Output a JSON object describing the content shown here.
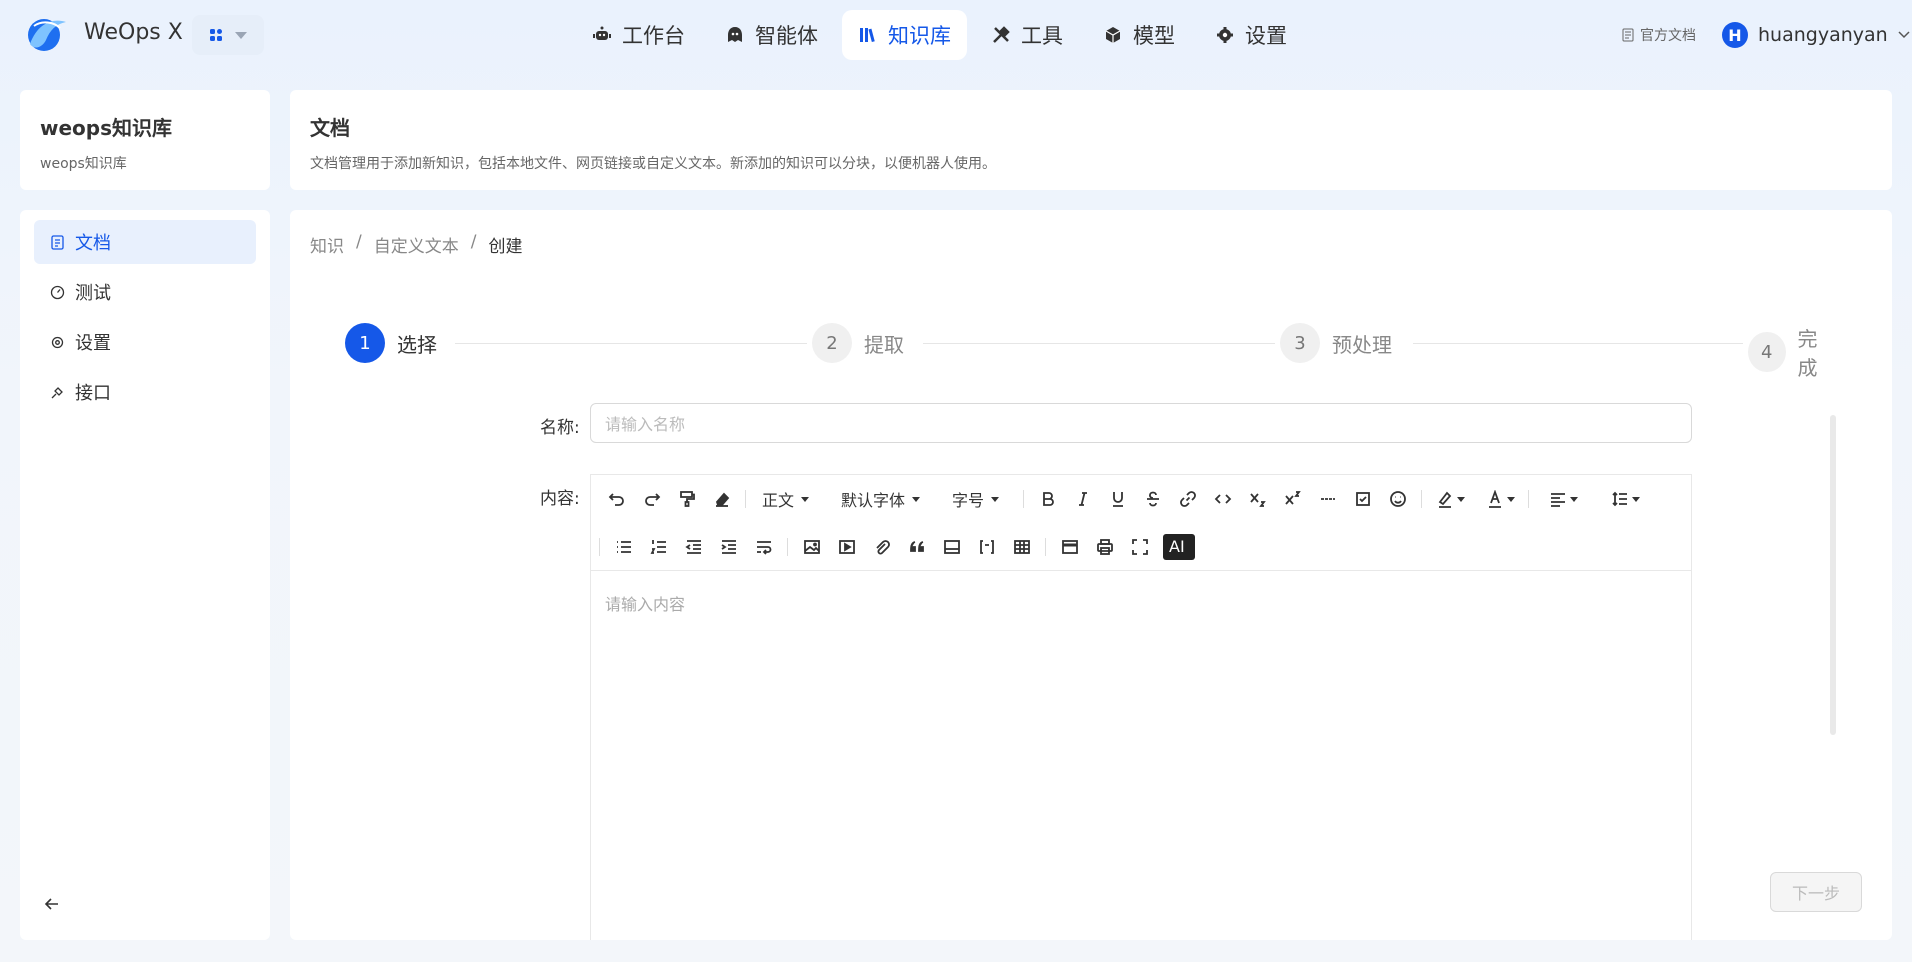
{
  "app": {
    "name": "WeOps X"
  },
  "nav": [
    {
      "label": "工作台",
      "icon": "robot-icon"
    },
    {
      "label": "智能体",
      "icon": "agent-icon"
    },
    {
      "label": "知识库",
      "icon": "library-icon",
      "active": true
    },
    {
      "label": "工具",
      "icon": "tools-icon"
    },
    {
      "label": "模型",
      "icon": "cube-icon"
    },
    {
      "label": "设置",
      "icon": "gear-icon"
    }
  ],
  "header_right": {
    "doc_link": "官方文档",
    "avatar_letter": "H",
    "username": "huangyanyan"
  },
  "kb": {
    "title": "weops知识库",
    "subtitle": "weops知识库"
  },
  "sidebar": {
    "items": [
      {
        "label": "文档",
        "active": true
      },
      {
        "label": "测试"
      },
      {
        "label": "设置"
      },
      {
        "label": "接口"
      }
    ]
  },
  "page": {
    "title": "文档",
    "description": "文档管理用于添加新知识，包括本地文件、网页链接或自定义文本。新添加的知识可以分块，以便机器人使用。"
  },
  "breadcrumb": [
    "知识",
    "自定义文本",
    "创建"
  ],
  "steps": [
    {
      "num": "1",
      "label": "选择",
      "active": true
    },
    {
      "num": "2",
      "label": "提取"
    },
    {
      "num": "3",
      "label": "预处理"
    },
    {
      "num": "4",
      "label": "完成"
    }
  ],
  "form": {
    "name_label": "名称:",
    "name_placeholder": "请输入名称",
    "content_label": "内容:",
    "content_placeholder": "请输入内容"
  },
  "toolbar": {
    "paragraph": "正文",
    "font": "默认字体",
    "font_size": "字号",
    "ai": "AI"
  },
  "next_button": "下一步",
  "colors": {
    "primary": "#1558e8"
  }
}
